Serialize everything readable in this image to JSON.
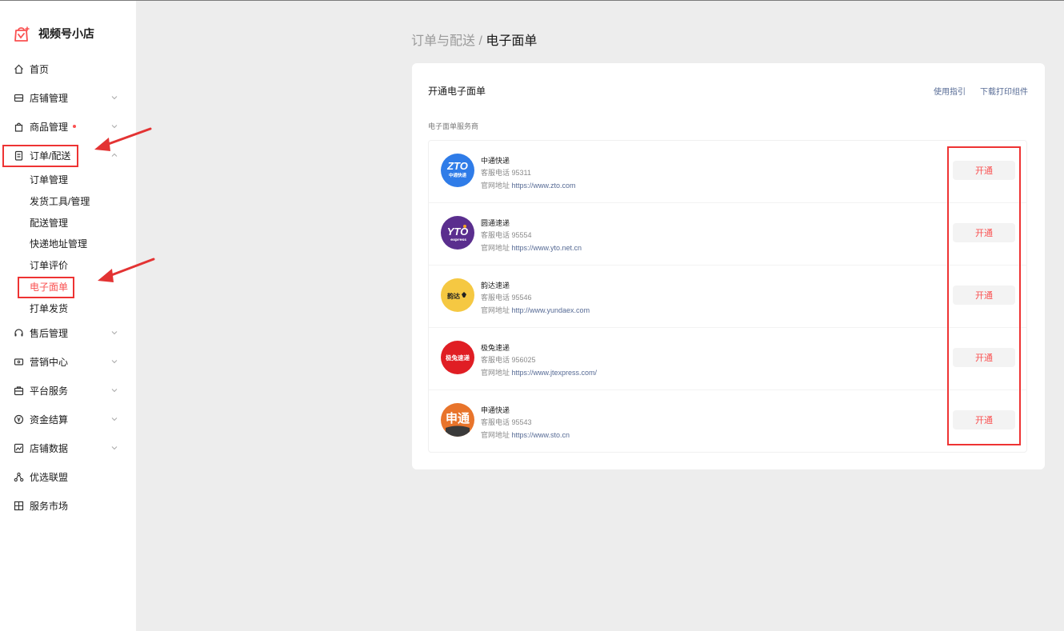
{
  "app": {
    "title": "视频号小店"
  },
  "colors": {
    "accent": "#fa5151",
    "link": "#576b95",
    "annotation": "#e33333"
  },
  "sidebar": {
    "items": [
      {
        "label": "首页",
        "icon": "home-icon",
        "expandable": false
      },
      {
        "label": "店铺管理",
        "icon": "store-icon",
        "expandable": true
      },
      {
        "label": "商品管理",
        "icon": "bag-icon",
        "expandable": true,
        "dot": true
      },
      {
        "label": "订单/配送",
        "icon": "order-icon",
        "expandable": true,
        "expanded": true
      },
      {
        "label": "售后管理",
        "icon": "headset-icon",
        "expandable": true
      },
      {
        "label": "营销中心",
        "icon": "coupon-icon",
        "expandable": true
      },
      {
        "label": "平台服务",
        "icon": "briefcase-icon",
        "expandable": true
      },
      {
        "label": "资金结算",
        "icon": "yen-icon",
        "expandable": true
      },
      {
        "label": "店铺数据",
        "icon": "chart-icon",
        "expandable": true
      },
      {
        "label": "优选联盟",
        "icon": "network-icon",
        "expandable": false
      },
      {
        "label": "服务市场",
        "icon": "grid-icon",
        "expandable": false
      }
    ],
    "order_subitems": [
      {
        "label": "订单管理"
      },
      {
        "label": "发货工具/管理"
      },
      {
        "label": "配送管理"
      },
      {
        "label": "快递地址管理"
      },
      {
        "label": "订单评价"
      },
      {
        "label": "电子面单",
        "active": true
      },
      {
        "label": "打单发货"
      }
    ]
  },
  "breadcrumb": {
    "parent": "订单与配送",
    "separator": " / ",
    "current": "电子面单"
  },
  "card": {
    "title": "开通电子面单",
    "links": {
      "guide": "使用指引",
      "download": "下载打印组件"
    },
    "section_label": "电子面单服务商",
    "phone_prefix": "客服电话 ",
    "url_prefix": "官网地址 ",
    "open_label": "开通",
    "couriers": [
      {
        "name": "中通快递",
        "phone": "95311",
        "url": "https://www.zto.com",
        "logo_text": "ZTO",
        "logo_sub": "中通快递",
        "logo_color": "#2f7ce8"
      },
      {
        "name": "圆通速递",
        "phone": "95554",
        "url": "https://www.yto.net.cn",
        "logo_text": "YTO",
        "logo_sub": "express",
        "logo_color": "#5a2e8e"
      },
      {
        "name": "韵达速递",
        "phone": "95546",
        "url": "http://www.yundaex.com",
        "logo_text": "韵达",
        "logo_sub": "",
        "logo_color": "#f5c842"
      },
      {
        "name": "极兔速递",
        "phone": "956025",
        "url": "https://www.jtexpress.com/",
        "logo_text": "极兔速递",
        "logo_sub": "",
        "logo_color": "#e01e24"
      },
      {
        "name": "申通快递",
        "phone": "95543",
        "url": "https://www.sto.cn",
        "logo_text": "申通",
        "logo_sub": "",
        "logo_color": "#e8742b"
      }
    ]
  }
}
